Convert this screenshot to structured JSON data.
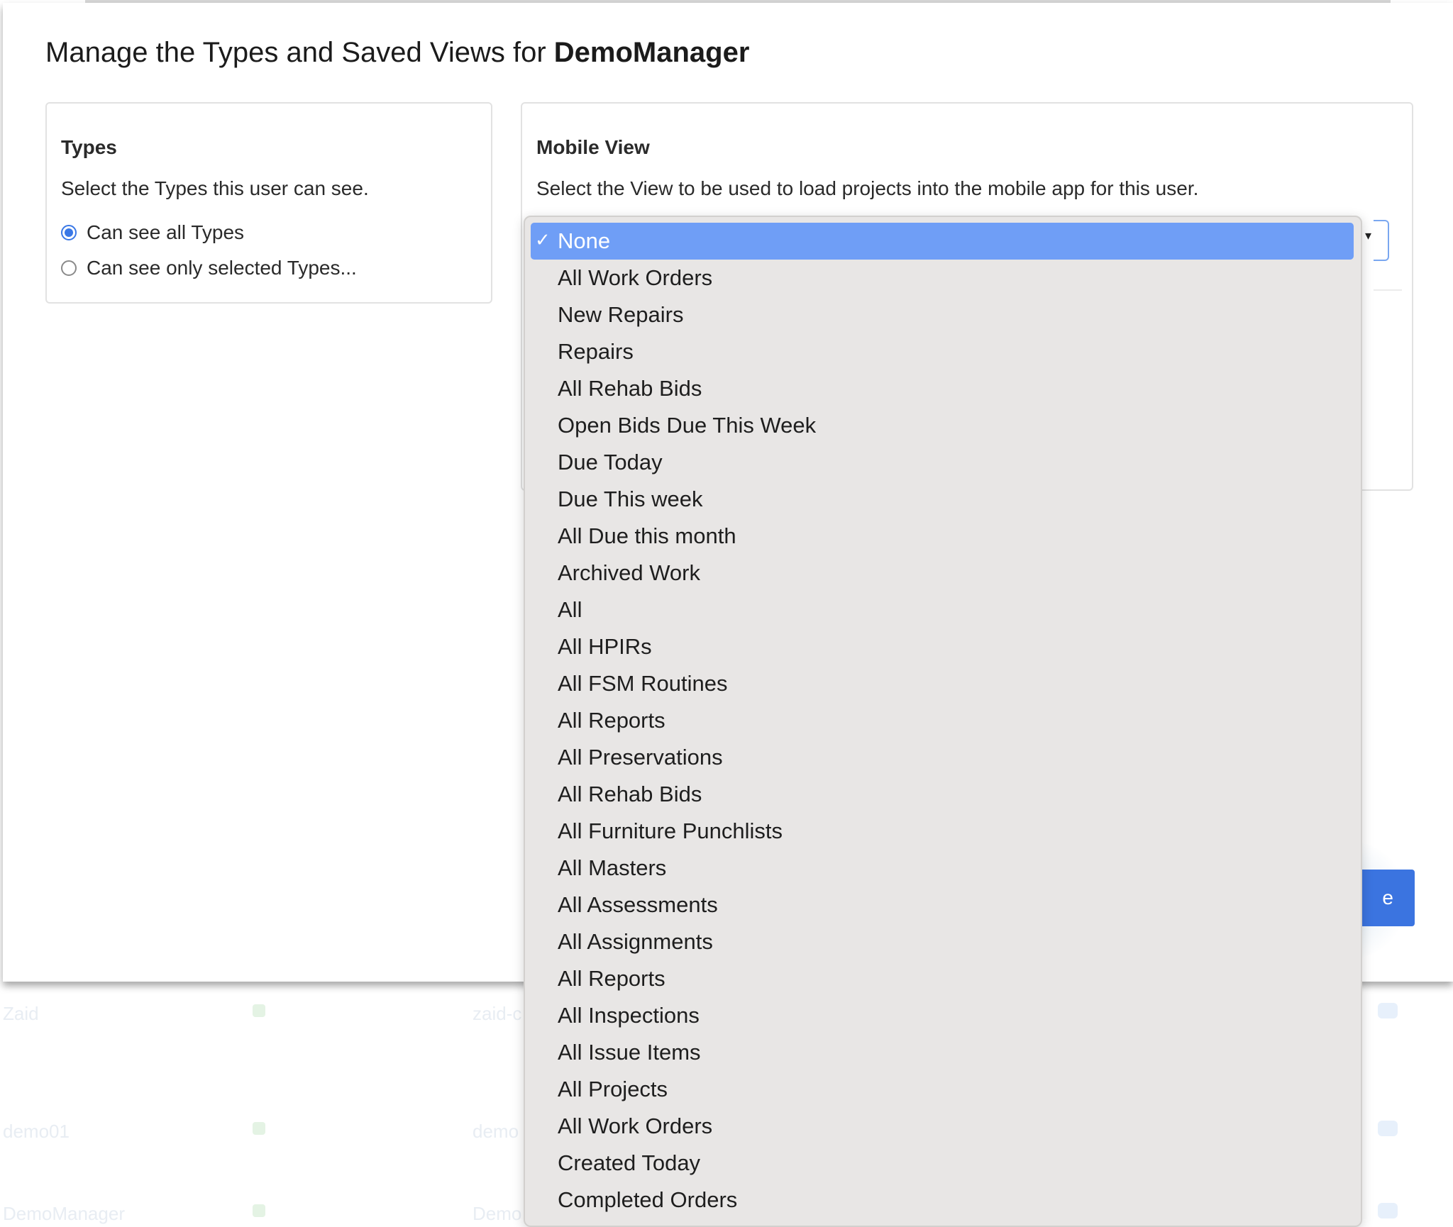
{
  "background_rows": [
    {
      "name": "Zaid",
      "email": "zaid-c"
    },
    {
      "name": "demo01",
      "email": "demo"
    },
    {
      "name": "DemoManager",
      "email": "Demo"
    }
  ],
  "modal": {
    "title_prefix": "Manage the Types and Saved Views for ",
    "title_user": "DemoManager",
    "save_label": "e"
  },
  "types_card": {
    "heading": "Types",
    "description": "Select the Types this user can see.",
    "options": [
      {
        "label": "Can see all Types",
        "checked": true
      },
      {
        "label": "Can see only selected Types...",
        "checked": false
      }
    ]
  },
  "mobile_card": {
    "heading": "Mobile View",
    "description": "Select the View to be used to load projects into the mobile app for this user."
  },
  "dropdown": {
    "selected_index": 0,
    "check_glyph": "✓",
    "options": [
      "None",
      "All Work Orders",
      "New Repairs",
      "Repairs",
      "All Rehab Bids",
      "Open Bids Due This Week",
      "Due Today",
      "Due This week",
      "All Due this month",
      "Archived Work",
      "All",
      "All HPIRs",
      "All FSM Routines",
      "All Reports",
      "All Preservations",
      "All Rehab Bids",
      "All Furniture Punchlists",
      "All Masters",
      "All Assessments",
      "All Assignments",
      "All Reports",
      "All Inspections",
      "All Issue Items",
      "All Projects",
      "All Work Orders",
      "Created Today",
      "Completed Orders"
    ]
  },
  "colors": {
    "accent": "#3b74e0",
    "dropdown_selected": "#6f9ef6",
    "dropdown_bg": "#e8e6e5"
  }
}
